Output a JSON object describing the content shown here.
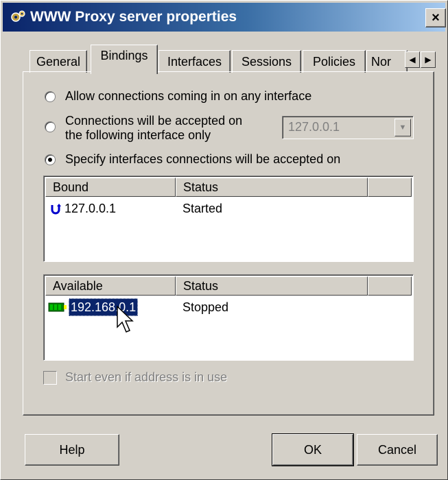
{
  "window": {
    "title": "WWW Proxy server properties",
    "close_label": "×"
  },
  "tabs": [
    {
      "label": "General",
      "active": false
    },
    {
      "label": "Bindings",
      "active": true
    },
    {
      "label": "Interfaces",
      "active": false
    },
    {
      "label": "Sessions",
      "active": false
    },
    {
      "label": "Policies",
      "active": false
    },
    {
      "label": "Nor",
      "active": false
    }
  ],
  "tab_scroll": {
    "left_label": "◀",
    "right_label": "▶"
  },
  "bindings": {
    "option_any": {
      "before": "Allow connections coming in on any interface"
    },
    "option_single": {
      "line1": "Connections will be accepted on",
      "line2": "the following interface only"
    },
    "option_specify": {
      "label": "Specify interfaces connections will be accepted on"
    },
    "selected_option": "specify",
    "interface_combo": {
      "value": "127.0.0.1",
      "arrow": "▼"
    }
  },
  "bound_list": {
    "columns": [
      "Bound",
      "Status",
      ""
    ],
    "rows": [
      {
        "address": "127.0.0.1",
        "status": "Started",
        "icon": "bound-arrow-icon"
      }
    ]
  },
  "available_list": {
    "columns": [
      "Available",
      "Status",
      ""
    ],
    "rows": [
      {
        "address": "192.168.0.1",
        "status": "Stopped",
        "icon": "network-card-icon",
        "selected": true
      }
    ]
  },
  "start_even": {
    "label": "Start even if address is in use",
    "checked": false,
    "enabled": false
  },
  "buttons": {
    "help": "Help",
    "ok": "OK",
    "cancel": "Cancel"
  },
  "colors": {
    "title_bar": "#0a246a",
    "selection": "#0a246a",
    "face": "#d4d0c8"
  }
}
